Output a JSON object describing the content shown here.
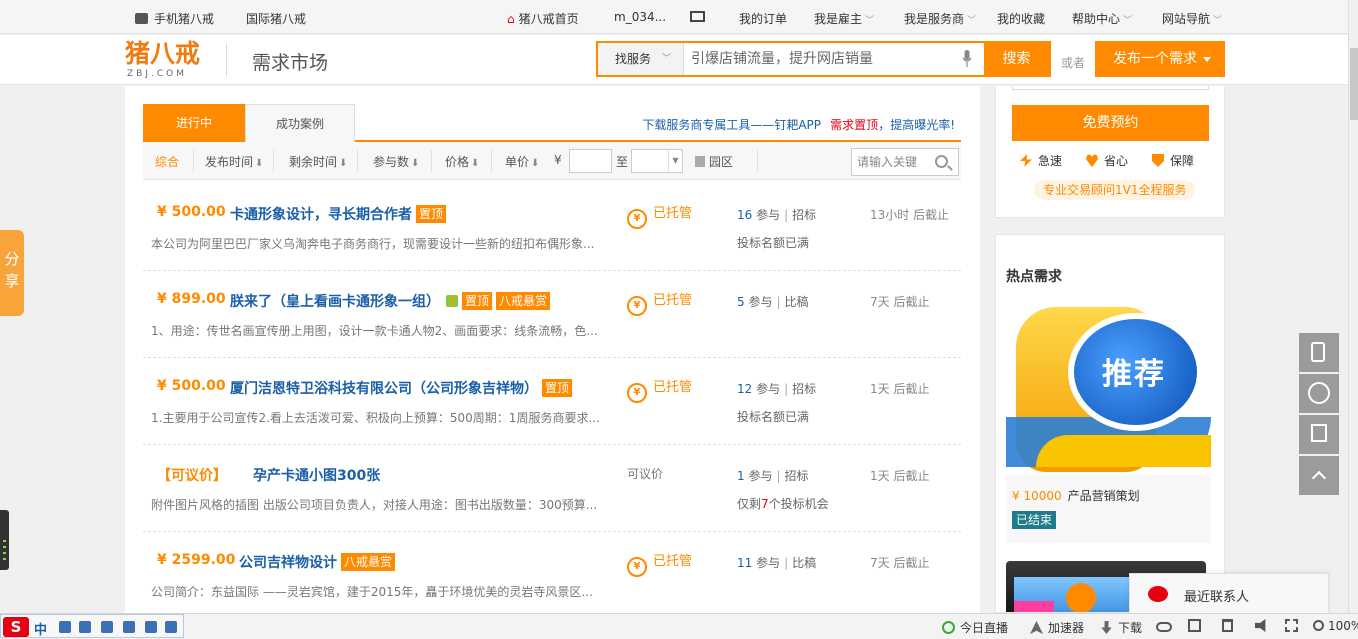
{
  "topbar": {
    "mobile": "手机猪八戒",
    "intl": "国际猪八戒",
    "home": "猪八戒首页",
    "user": "m_034...",
    "orders": "我的订单",
    "employer": "我是雇主",
    "provider": "我是服务商",
    "favorites": "我的收藏",
    "help": "帮助中心",
    "nav": "网站导航"
  },
  "header": {
    "logo_cn": "猪八戒",
    "logo_en": "ZBJ.COM",
    "market": "需求市场",
    "search_type": "找服务",
    "search_placeholder": "引爆店铺流量，提升网店销量",
    "search_button": "搜索",
    "or": "或者",
    "publish": "发布一个需求"
  },
  "tabs": {
    "active": "进行中",
    "cases": "成功案例",
    "download": "下载服务商专属工具——钉耙APP",
    "promo_red": "需求置顶",
    "promo_blue": "，提高曝光率!"
  },
  "filters": {
    "all": "综合",
    "publish_time": "发布时间",
    "remaining_time": "剩余时间",
    "participants": "参与数",
    "price": "价格",
    "unit_price": "单价",
    "currency": "¥",
    "to": "至",
    "park": "园区",
    "keyword_placeholder": "请输入关键"
  },
  "tasks": [
    {
      "price": "¥ 500.00",
      "title": "卡通形象设计，寻长期合作者",
      "tags": [
        "置顶"
      ],
      "desc": "本公司为阿里巴巴厂家义乌淘奔电子商务商行，现需要设计一些新的纽扣布偶形象...",
      "escrow": "已托管",
      "count": "16",
      "count_unit": "参与",
      "mode": "招标",
      "deadline": "13小时 后截止",
      "note": "投标名额已满"
    },
    {
      "price": "¥ 899.00",
      "title": "朕来了（皇上看画卡通形象一组）",
      "gift": true,
      "tags": [
        "置顶",
        "八戒悬赏"
      ],
      "desc": "1、用途：传世名画宣传册上用图，设计一款卡通人物2、画面要求：线条流畅，色...",
      "escrow": "已托管",
      "count": "5",
      "count_unit": "参与",
      "mode": "比稿",
      "deadline": "7天 后截止",
      "note": ""
    },
    {
      "price": "¥ 500.00",
      "title": "厦门洁恩特卫浴科技有限公司（公司形象吉祥物）",
      "tags": [
        "置顶"
      ],
      "desc": "1.主要用于公司宣传2.看上去活泼可爱、积极向上预算：500周期：1周服务商要求...",
      "escrow": "已托管",
      "count": "12",
      "count_unit": "参与",
      "mode": "招标",
      "deadline": "1天 后截止",
      "note": "投标名额已满"
    },
    {
      "price": "【可议价】",
      "title": "孕产卡通小图300张",
      "tags": [],
      "desc": "附件图片风格的插图 出版公司项目负责人，对接人用途：图书出版数量：300预算...",
      "negotiable": "可议价",
      "count": "1",
      "count_unit": "参与",
      "mode": "招标",
      "deadline": "1天 后截止",
      "note_prefix": "仅剩",
      "note_num": "7",
      "note_suffix": "个投标机会"
    },
    {
      "price": "¥ 2599.00",
      "title": "公司吉祥物设计",
      "tags": [
        "八戒悬赏"
      ],
      "desc": "公司简介：东益国际 ——灵岩宾馆，建于2015年，矗于环境优美的灵岩寺风景区...",
      "escrow": "已托管",
      "count": "11",
      "count_unit": "参与",
      "mode": "比稿",
      "deadline": "7天 后截止",
      "note": ""
    }
  ],
  "escrow_coin": "¥",
  "right": {
    "reserve": "免费预约",
    "fast": "急速",
    "save": "省心",
    "guarantee": "保障",
    "consult": "专业交易顾问1V1全程服务",
    "hot_title": "热点需求",
    "hot_img_text": "推荐",
    "hot_price": "¥ 10000",
    "hot_name": "产品营销策划",
    "hot_status": "已结束"
  },
  "share": "分享",
  "contact": "最近联系人",
  "statusbar": {
    "ime_s": "S",
    "ime_zh": "中",
    "live": "今日直播",
    "accelerator": "加速器",
    "download": "下载",
    "zoom": "100%"
  },
  "colors": {
    "accent": "#ff8a00",
    "link": "#1a5fa8",
    "red": "#e60012"
  }
}
